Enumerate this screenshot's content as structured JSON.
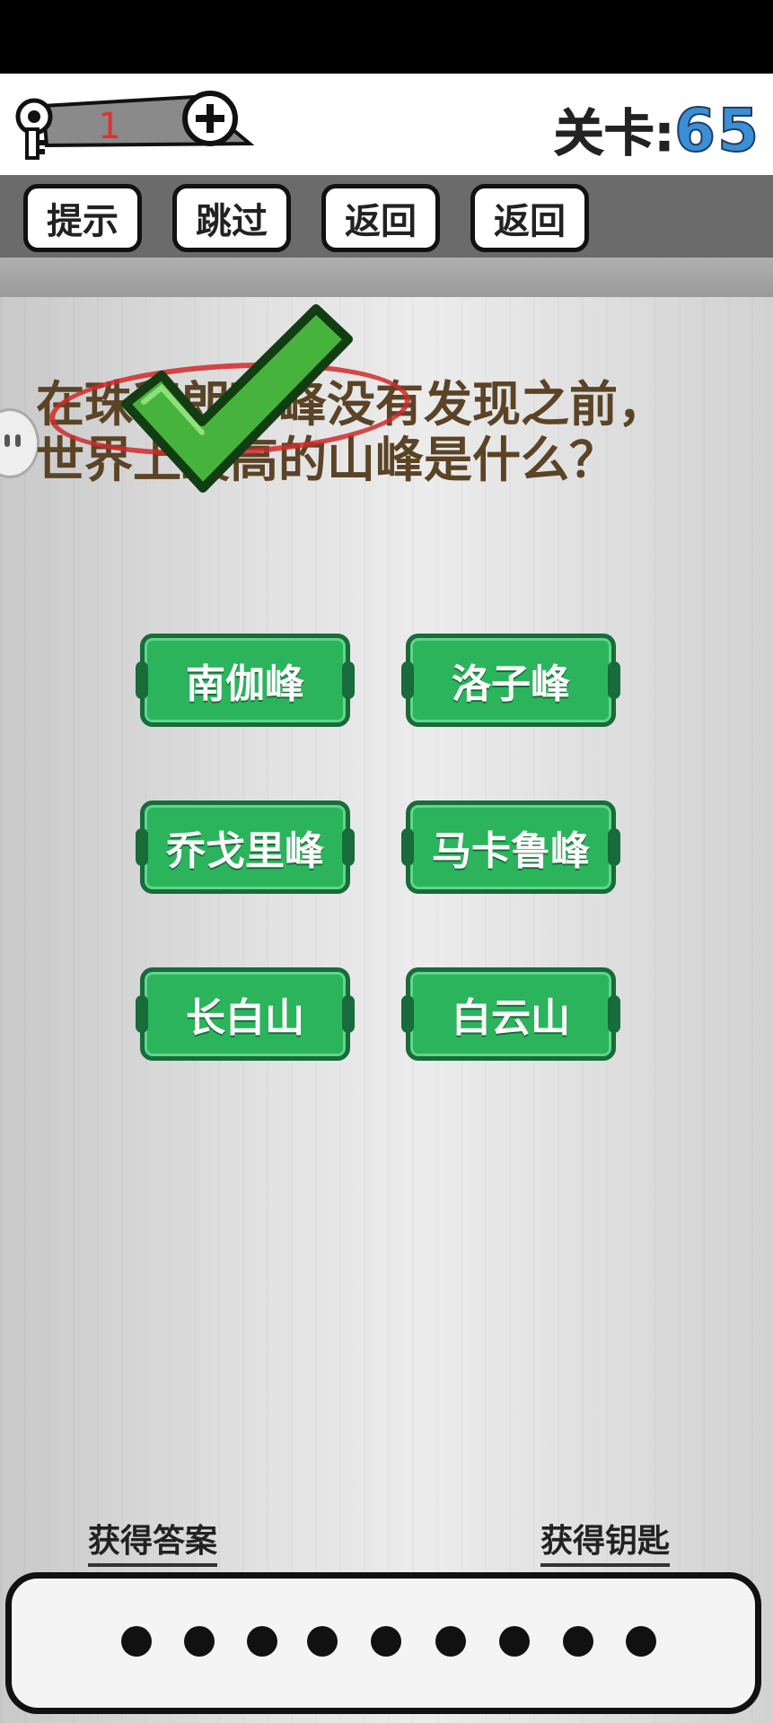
{
  "header": {
    "key_count": "1",
    "level_label": "关卡:",
    "level_value": "65"
  },
  "toolbar": {
    "hint_label": "提示",
    "skip_label": "跳过",
    "back_label_1": "返回",
    "back_label_2": "返回"
  },
  "question": {
    "line1": "在珠穆朗玛峰没有发现之前，",
    "line2": "世界上最高的山峰是什么？"
  },
  "answers": [
    "南伽峰",
    "洛子峰",
    "乔戈里峰",
    "马卡鲁峰",
    "长白山",
    "白云山"
  ],
  "footer": {
    "get_answer_label": "获得答案",
    "get_key_label": "获得钥匙"
  },
  "answer_slots_count": 9,
  "colors": {
    "answer_green": "#2bb45c",
    "level_blue": "#3b8fd6",
    "check_green": "#46b43c",
    "question_brown": "#5b4326",
    "key_count_red": "#e03030"
  }
}
